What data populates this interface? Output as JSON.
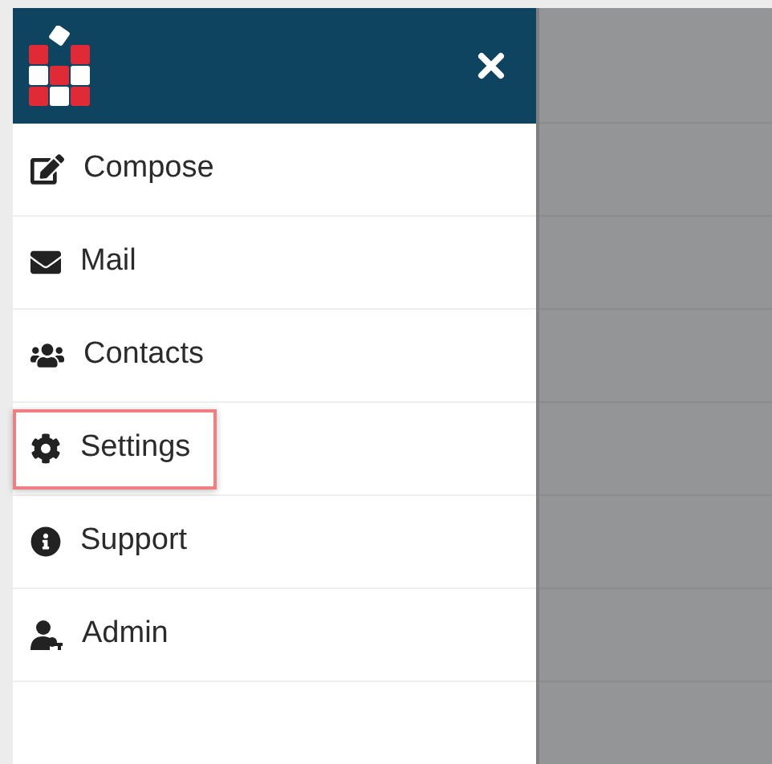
{
  "menu": [
    {
      "kind": "compose",
      "label": "Compose",
      "selected": false
    },
    {
      "kind": "mail",
      "label": "Mail",
      "selected": false
    },
    {
      "kind": "contacts",
      "label": "Contacts",
      "selected": false
    },
    {
      "kind": "settings",
      "label": "Settings",
      "selected": true
    },
    {
      "kind": "support",
      "label": "Support",
      "selected": false
    },
    {
      "kind": "admin",
      "label": "Admin",
      "selected": false
    }
  ]
}
